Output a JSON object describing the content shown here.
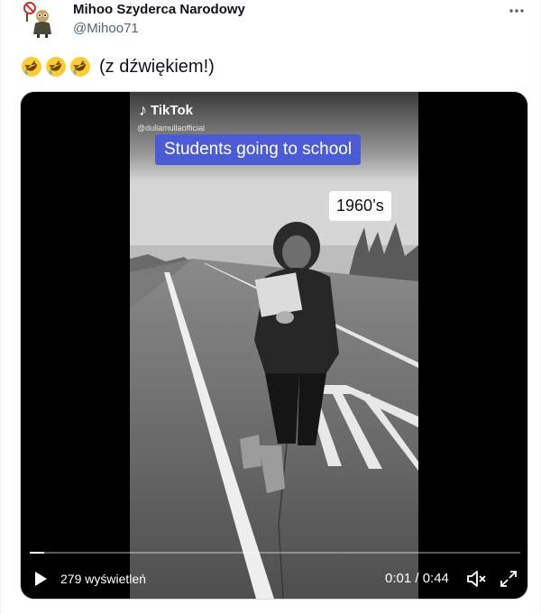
{
  "author": {
    "display_name": "Mihoo Szyderca Narodowy",
    "handle": "@Mihoo71"
  },
  "tweet": {
    "emojis": [
      "rolling-on-floor-laughing-emoji",
      "rolling-on-floor-laughing-emoji",
      "rolling-on-floor-laughing-emoji"
    ],
    "text": "(z dźwiękiem!)"
  },
  "video": {
    "watermark_brand": "TikTok",
    "watermark_user": "@dullamullaofficial",
    "caption": "Students going to school",
    "year_label": "1960’s",
    "views_label": "279 wyświetleń",
    "time_label": "0:01 / 0:44",
    "progress": 0.03
  },
  "icons": {
    "more": "more-horizontal-icon",
    "play": "play-icon",
    "volume": "volume-muted-icon",
    "fullscreen": "fullscreen-icon"
  },
  "colors": {
    "caption_bg": "#4b5bd6",
    "handle": "#536471"
  }
}
